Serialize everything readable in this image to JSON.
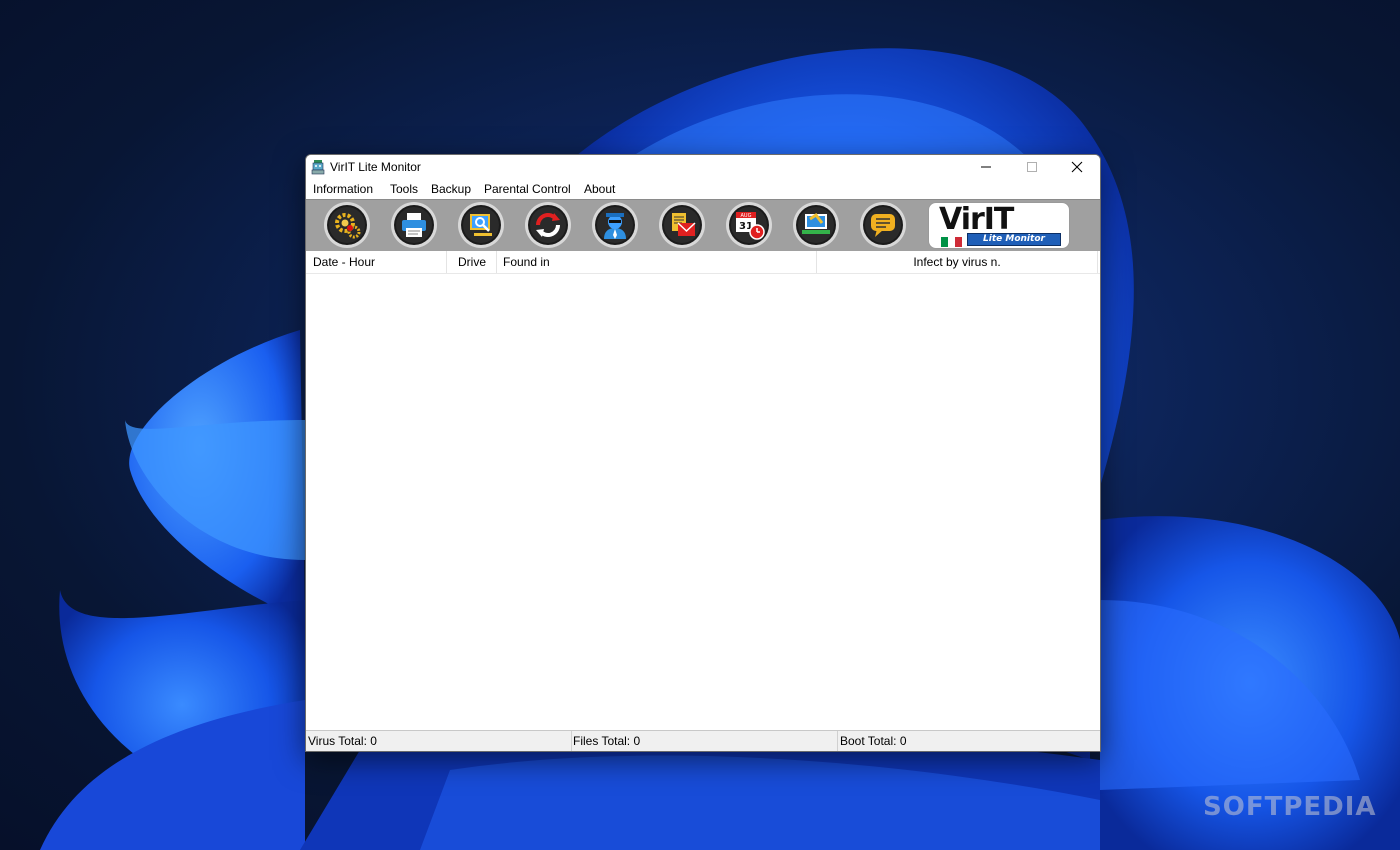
{
  "window": {
    "title": "VirIT Lite Monitor"
  },
  "menu": {
    "items": [
      "Information",
      "Tools",
      "Backup",
      "Parental Control",
      "About"
    ]
  },
  "toolbar": {
    "buttons": [
      {
        "icon": "settings-gears-icon"
      },
      {
        "icon": "printer-icon"
      },
      {
        "icon": "monitor-scan-icon"
      },
      {
        "icon": "update-refresh-icon"
      },
      {
        "icon": "spy-agent-icon"
      },
      {
        "icon": "mail-report-icon"
      },
      {
        "icon": "calendar-scheduler-icon"
      },
      {
        "icon": "laptop-shield-icon"
      },
      {
        "icon": "chat-message-icon"
      }
    ],
    "logo": {
      "text": "VirIT",
      "subtitle": "Lite Monitor",
      "flag_colors": [
        "#009246",
        "#ffffff",
        "#ce2b37"
      ]
    }
  },
  "table": {
    "columns": [
      "Date - Hour",
      "Drive",
      "Found in",
      "Infect by virus n."
    ],
    "rows": []
  },
  "status": {
    "virus_total": "Virus Total: 0",
    "files_total": "Files Total: 0",
    "boot_total": "Boot Total: 0"
  },
  "watermark": "SOFTPEDIA",
  "colors": {
    "toolbar_bg": "#a0a0a0",
    "logo_accent": "#1f5fb8"
  }
}
